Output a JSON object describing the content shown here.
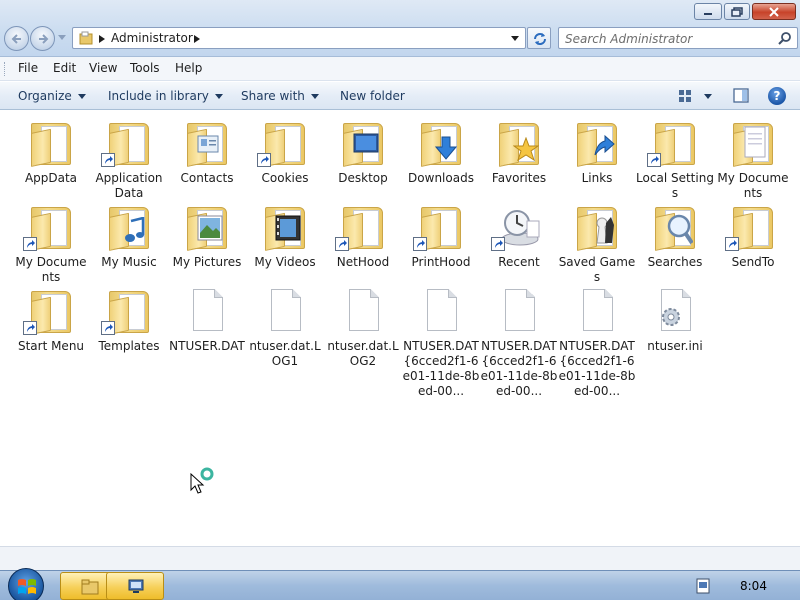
{
  "window": {
    "controls": [
      "minimize-icon",
      "maximize-icon",
      "close-icon"
    ]
  },
  "address": {
    "path": "Administrator",
    "refresh_icon": "refresh-icon"
  },
  "search": {
    "placeholder": "Search Administrator",
    "icon": "search-icon"
  },
  "menu": {
    "items": [
      "File",
      "Edit",
      "View",
      "Tools",
      "Help"
    ]
  },
  "commands": {
    "organize": "Organize",
    "include_in_library": "Include in library",
    "share_with": "Share with",
    "new_folder": "New folder"
  },
  "files": [
    {
      "label": "AppData",
      "kind": "folder",
      "shortcut": false
    },
    {
      "label": "Application Data",
      "kind": "folder",
      "shortcut": true
    },
    {
      "label": "Contacts",
      "kind": "folder-contacts",
      "shortcut": false
    },
    {
      "label": "Cookies",
      "kind": "folder",
      "shortcut": true
    },
    {
      "label": "Desktop",
      "kind": "folder-desktop",
      "shortcut": false
    },
    {
      "label": "Downloads",
      "kind": "folder-downloads",
      "shortcut": false
    },
    {
      "label": "Favorites",
      "kind": "folder-favorites",
      "shortcut": false
    },
    {
      "label": "Links",
      "kind": "folder-links",
      "shortcut": false
    },
    {
      "label": "Local Settings",
      "kind": "folder",
      "shortcut": true
    },
    {
      "label": "My Documents",
      "kind": "folder-documents",
      "shortcut": false
    },
    {
      "label": "My Documents",
      "kind": "folder",
      "shortcut": true
    },
    {
      "label": "My Music",
      "kind": "folder-music",
      "shortcut": false
    },
    {
      "label": "My Pictures",
      "kind": "folder-pictures",
      "shortcut": false
    },
    {
      "label": "My Videos",
      "kind": "folder-videos",
      "shortcut": false
    },
    {
      "label": "NetHood",
      "kind": "folder",
      "shortcut": true
    },
    {
      "label": "PrintHood",
      "kind": "folder",
      "shortcut": true
    },
    {
      "label": "Recent",
      "kind": "recent",
      "shortcut": true
    },
    {
      "label": "Saved Games",
      "kind": "folder-games",
      "shortcut": false
    },
    {
      "label": "Searches",
      "kind": "folder-searches",
      "shortcut": false
    },
    {
      "label": "SendTo",
      "kind": "folder",
      "shortcut": true
    },
    {
      "label": "Start Menu",
      "kind": "folder",
      "shortcut": true
    },
    {
      "label": "Templates",
      "kind": "folder",
      "shortcut": true
    },
    {
      "label": "NTUSER.DAT",
      "kind": "file",
      "shortcut": false
    },
    {
      "label": "ntuser.dat.LOG1",
      "kind": "file",
      "shortcut": false
    },
    {
      "label": "ntuser.dat.LOG2",
      "kind": "file",
      "shortcut": false
    },
    {
      "label": "NTUSER.DAT{6cced2f1-6e01-11de-8bed-00...",
      "kind": "file",
      "shortcut": false
    },
    {
      "label": "NTUSER.DAT{6cced2f1-6e01-11de-8bed-00...",
      "kind": "file",
      "shortcut": false
    },
    {
      "label": "NTUSER.DAT{6cced2f1-6e01-11de-8bed-00...",
      "kind": "file",
      "shortcut": false
    },
    {
      "label": "ntuser.ini",
      "kind": "file-settings",
      "shortcut": false
    }
  ],
  "taskbar": {
    "start_icon": "windows-logo-icon",
    "apps": [
      "explorer-icon",
      "remote-desktop-icon"
    ],
    "clock": "8:04"
  },
  "colors": {
    "accent": "#1e3a5f",
    "folder": "#f4dc8d"
  }
}
